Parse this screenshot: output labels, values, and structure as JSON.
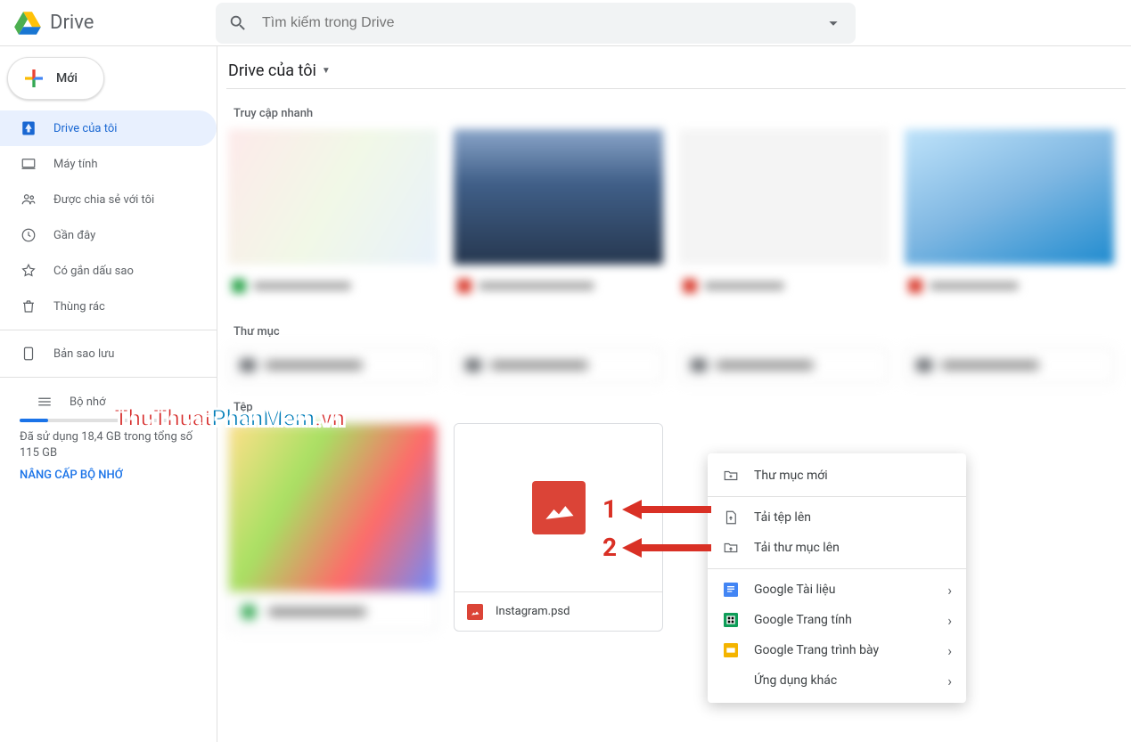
{
  "header": {
    "app_name": "Drive",
    "search_placeholder": "Tìm kiếm trong Drive"
  },
  "sidebar": {
    "new_label": "Mới",
    "items": [
      {
        "label": "Drive của tôi",
        "icon": "drive"
      },
      {
        "label": "Máy tính",
        "icon": "computer"
      },
      {
        "label": "Được chia sẻ với tôi",
        "icon": "people"
      },
      {
        "label": "Gần đây",
        "icon": "clock"
      },
      {
        "label": "Có gắn dấu sao",
        "icon": "star"
      },
      {
        "label": "Thùng rác",
        "icon": "trash"
      }
    ],
    "backup_label": "Bản sao lưu",
    "storage": {
      "title": "Bộ nhớ",
      "text": "Đã sử dụng 18,4 GB trong tổng số 115 GB",
      "upgrade": "NÂNG CẤP BỘ NHỚ",
      "percent": 16
    }
  },
  "main": {
    "breadcrumb": "Drive của tôi",
    "quick_access_label": "Truy cập nhanh",
    "folders_label": "Thư mục",
    "files_label": "Tệp",
    "file_name_1": "Instagram.psd"
  },
  "context_menu": {
    "new_folder": "Thư mục mới",
    "upload_file": "Tải tệp lên",
    "upload_folder": "Tải thư mục lên",
    "google_docs": "Google Tài liệu",
    "google_sheets": "Google Trang tính",
    "google_slides": "Google Trang trình bày",
    "more_apps": "Ứng dụng khác"
  },
  "annotations": {
    "n1": "1",
    "n2": "2"
  },
  "watermark": {
    "part1": "ThuThuat",
    "part2": "PhanMem",
    "part3": ".vn"
  }
}
